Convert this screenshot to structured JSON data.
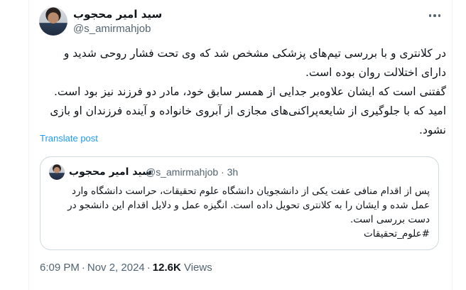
{
  "author": {
    "display_name": "سید امیر محجوب",
    "handle": "@s_amirmahjob"
  },
  "tweet": {
    "lines": [
      "در کلانتری و با بررسی تیم‌های پزشکی مشخص شد که وی تحت فشار روحی شدید و",
      "دارای اختلالت روان بوده است.",
      "گفتنی است که ایشان علاوه‌بر جدایی از همسر سابق خود، مادر دو فرزند نیز بود است.",
      "امید که با جلوگیری از شایعه‌پراکنی‌های مجازی از آبروی خانواده و آینده فرزندان او بازی",
      "نشود."
    ],
    "translate_label": "Translate post"
  },
  "quote": {
    "display_name": "سید امیر محجوب",
    "handle": "@s_amirmahjob",
    "time": "3h",
    "lines": [
      "پس از اقدام منافی عفت یکی از دانشجویان دانشگاه علوم تحقیقات، حراست دانشگاه وارد",
      "عمل شده و ایشان را به کلانتری تحویل داده است. انگیزه عمل و دلایل اقدام این دانشجو در",
      "دست بررسی است.",
      "#علوم_تحقیقات"
    ]
  },
  "footer": {
    "time": "6:09 PM",
    "date": "Nov 2, 2024",
    "views_count": "12.6K",
    "views_label": "Views"
  },
  "icons": {
    "more": "more-dots-icon"
  },
  "colors": {
    "link": "#1d9bf0",
    "muted": "#536471",
    "text": "#0f1419",
    "border": "#cfd9de"
  }
}
